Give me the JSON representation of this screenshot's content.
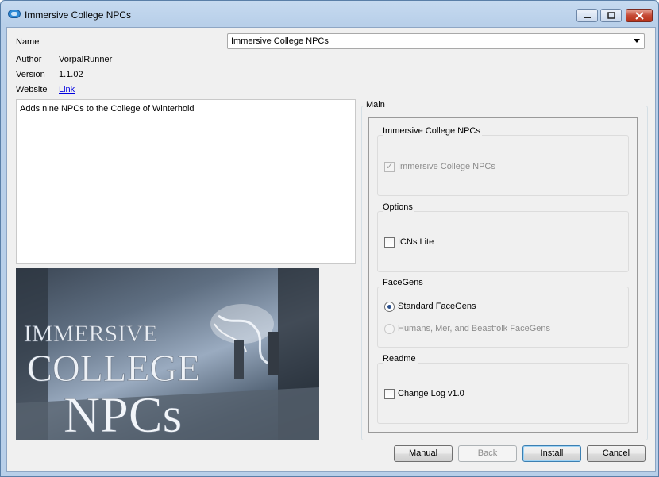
{
  "window": {
    "title": "Immersive College NPCs"
  },
  "info": {
    "name_label": "Name",
    "name_value": "Immersive College NPCs",
    "author_label": "Author",
    "author_value": "VorpalRunner",
    "version_label": "Version",
    "version_value": "1.1.02",
    "website_label": "Website",
    "website_link": "Link"
  },
  "description": "Adds nine NPCs to the College of Winterhold",
  "banner": {
    "line1": "IMMERSIVE",
    "line2": "COLLEGE",
    "line3": "NPCs"
  },
  "main": {
    "label": "Main",
    "groups": [
      {
        "title": "Immersive College NPCs",
        "option": "Immersive College NPCs",
        "checked": true,
        "disabled": true
      },
      {
        "title": "Options",
        "option": "ICNs Lite",
        "checked": false,
        "disabled": false
      },
      {
        "title": "FaceGens",
        "options": [
          "Standard FaceGens",
          "Humans, Mer, and Beastfolk FaceGens"
        ],
        "selected": 0
      },
      {
        "title": "Readme",
        "option": "Change Log v1.0",
        "checked": false,
        "disabled": false
      }
    ]
  },
  "buttons": {
    "manual": "Manual",
    "back": "Back",
    "install": "Install",
    "cancel": "Cancel"
  }
}
